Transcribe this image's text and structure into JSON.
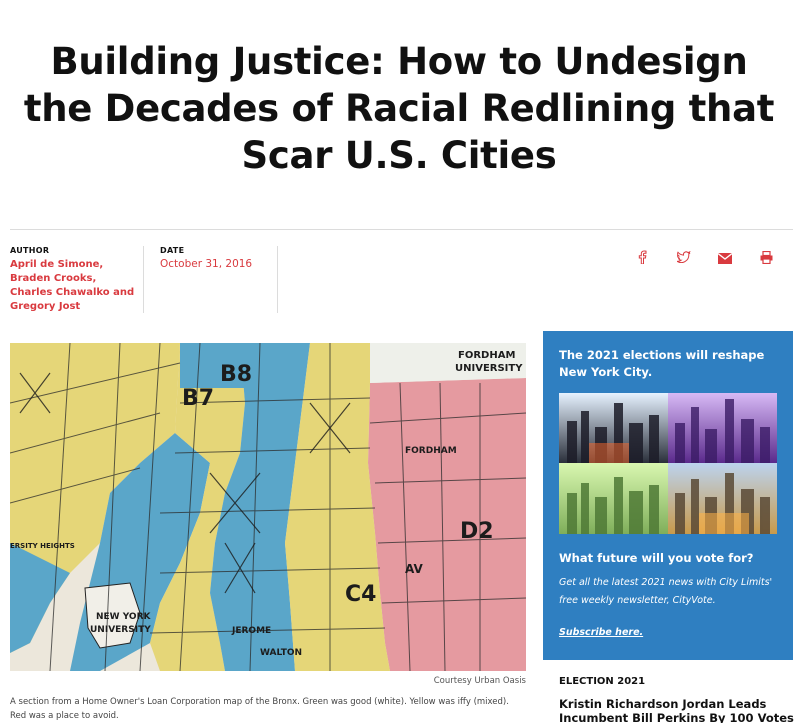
{
  "article": {
    "title": "Building Justice: How to Undesign the Decades of Racial Redlining that Scar U.S. Cities",
    "author_label": "AUTHOR",
    "authors": "April de Simone, Braden Crooks, Charles Chawalko and Gregory Jost",
    "date_label": "DATE",
    "date": "October 31, 2016",
    "image_credit": "Courtesy Urban Oasis",
    "caption": "A section from a Home Owner's Loan Corporation map of the Bronx. Green was good (white). Yellow was iffy (mixed). Red was a place to avoid."
  },
  "share": {
    "icons": [
      "facebook-icon",
      "twitter-icon",
      "email-icon",
      "print-icon"
    ],
    "color": "#d93a3f"
  },
  "map_labels": {
    "district_b8": "B8",
    "district_b7": "B7",
    "district_d2": "D2",
    "district_c4": "C4",
    "fordham": "FORDHAM",
    "university": "UNIVERSITY",
    "new_york": "NEW YORK",
    "nyu": "UNIVERSITY",
    "heights": "ERSITY HEIGHTS",
    "av_label": "AV",
    "fordham_street": "FORDHAM",
    "jerome": "JEROME",
    "walton": "WALTON"
  },
  "promo": {
    "title": "The 2021 elections will reshape New York City.",
    "question": "What future will you vote for?",
    "description": "Get all the latest 2021 news with City Limits' free weekly newsletter, CityVote.",
    "subscribe": "Subscribe here.",
    "background": "#2f7fc1"
  },
  "related": {
    "section": "ELECTION 2021",
    "title": "Kristin Richardson Jordan Leads Incumbent Bill Perkins By 100 Votes"
  },
  "colors": {
    "accent": "#d93a3f",
    "map_yellow": "#e7d775",
    "map_blue": "#5aa6c9",
    "map_red": "#e59aa0"
  }
}
